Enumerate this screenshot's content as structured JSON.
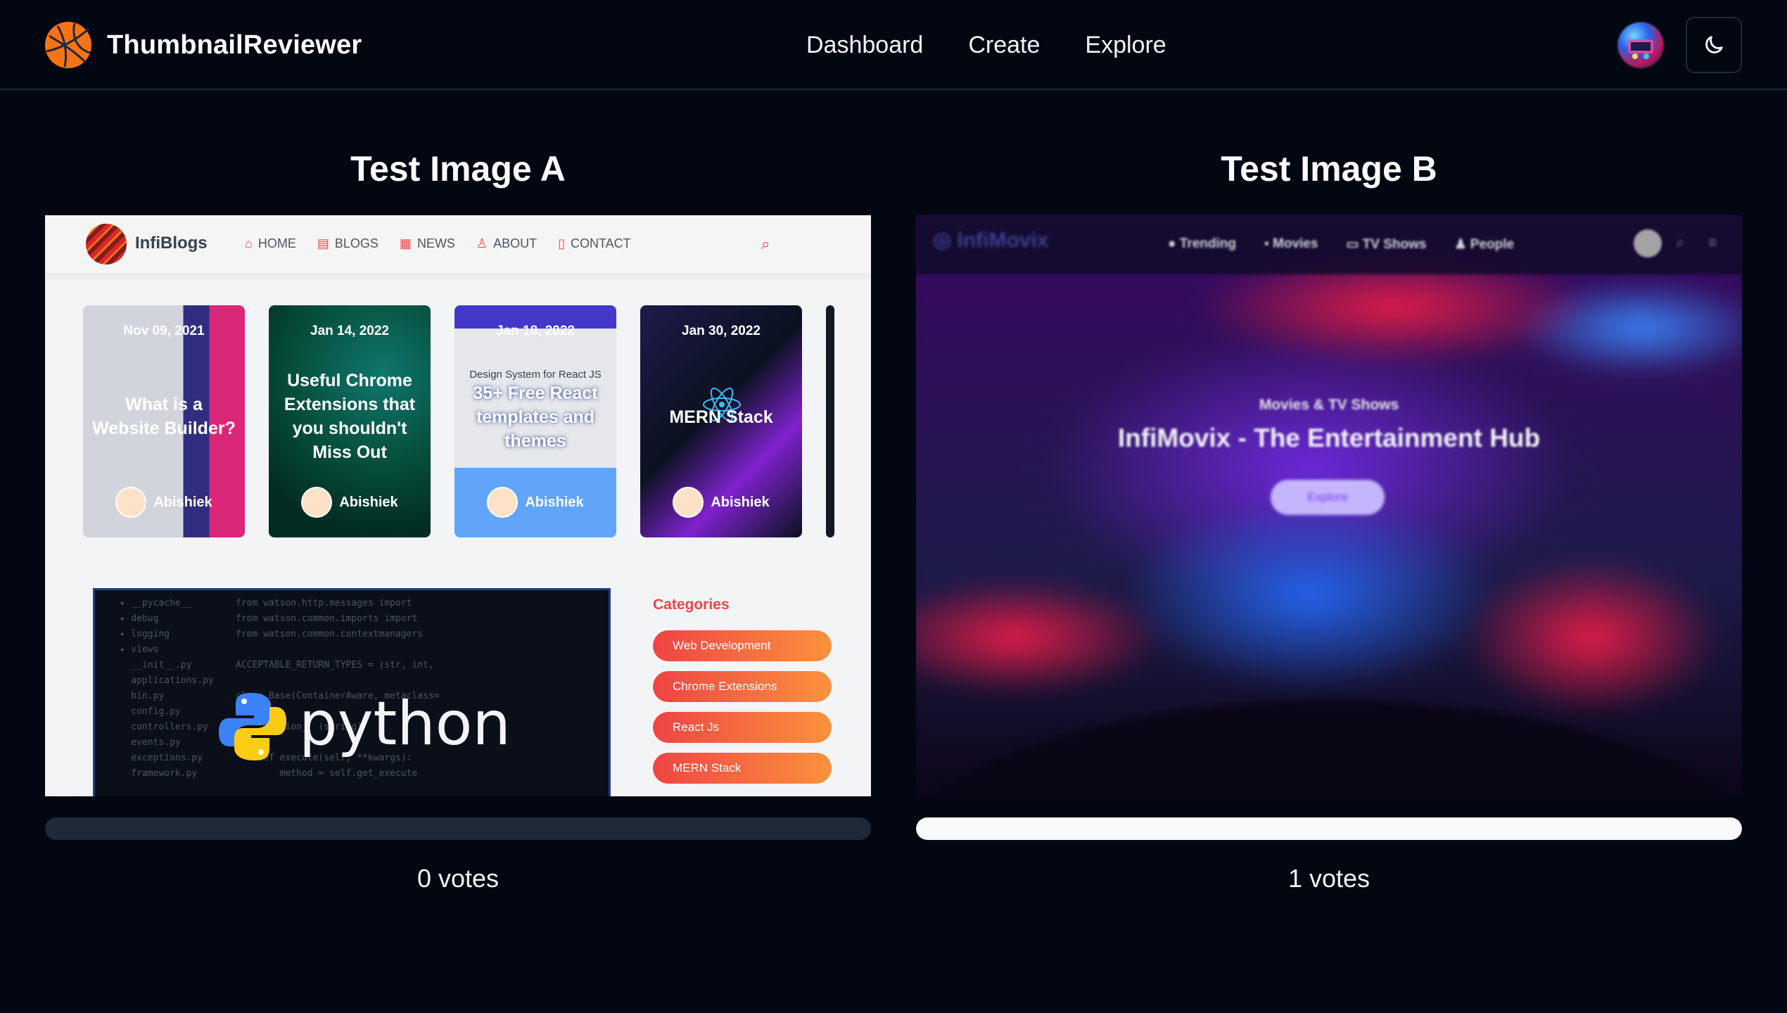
{
  "app": {
    "name": "ThumbnailReviewer",
    "nav": [
      "Dashboard",
      "Create",
      "Explore"
    ]
  },
  "tests": [
    {
      "title": "Test Image A",
      "votes_label": "0 votes",
      "votes": 0,
      "vote_share": 0,
      "thumbnail": {
        "brand": "InfiBlogs",
        "menu": [
          "HOME",
          "BLOGS",
          "NEWS",
          "ABOUT",
          "CONTACT"
        ],
        "cards": [
          {
            "date": "Nov 09, 2021",
            "title": "What is a Website Builder?",
            "author": "Abishiek"
          },
          {
            "date": "Jan 14, 2022",
            "title": "Useful Chrome Extensions that you shouldn't Miss Out",
            "author": "Abishiek"
          },
          {
            "date": "Jan 18, 2022",
            "title": "35+ Free React templates and themes",
            "author": "Abishiek"
          },
          {
            "date": "Jan 30, 2022",
            "title": "MERN Stack",
            "author": "Abishiek"
          }
        ],
        "card3_subtitle": "Design System for React JS",
        "featured_text": "python",
        "categories_title": "Categories",
        "categories": [
          "Web Development",
          "Chrome Extensions",
          "React Js",
          "MERN Stack"
        ]
      }
    },
    {
      "title": "Test Image B",
      "votes_label": "1 votes",
      "votes": 1,
      "vote_share": 1,
      "thumbnail": {
        "brand": "InfiMovix",
        "menu": [
          "Trending",
          "Movies",
          "TV Shows",
          "People"
        ],
        "subtitle": "Movies & TV Shows",
        "title": "InfiMovix - The Entertainment Hub",
        "button": "Explore"
      }
    }
  ],
  "colors": {
    "background": "#030712",
    "accent": "#f97316",
    "bar_track": "#1f2937",
    "bar_fill": "#f9fafb"
  },
  "icons": [
    "globe-logo-icon",
    "user-avatar",
    "moon-icon"
  ]
}
